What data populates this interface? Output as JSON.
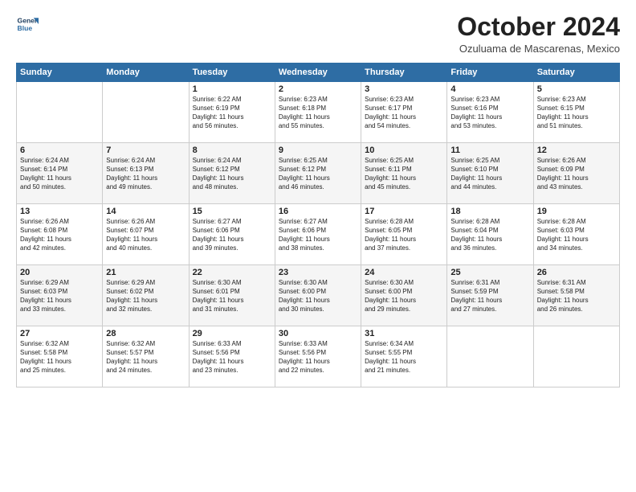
{
  "logo": {
    "line1": "General",
    "line2": "Blue"
  },
  "title": "October 2024",
  "subtitle": "Ozuluama de Mascarenas, Mexico",
  "weekdays": [
    "Sunday",
    "Monday",
    "Tuesday",
    "Wednesday",
    "Thursday",
    "Friday",
    "Saturday"
  ],
  "weeks": [
    [
      {
        "day": "",
        "text": ""
      },
      {
        "day": "",
        "text": ""
      },
      {
        "day": "1",
        "text": "Sunrise: 6:22 AM\nSunset: 6:19 PM\nDaylight: 11 hours\nand 56 minutes."
      },
      {
        "day": "2",
        "text": "Sunrise: 6:23 AM\nSunset: 6:18 PM\nDaylight: 11 hours\nand 55 minutes."
      },
      {
        "day": "3",
        "text": "Sunrise: 6:23 AM\nSunset: 6:17 PM\nDaylight: 11 hours\nand 54 minutes."
      },
      {
        "day": "4",
        "text": "Sunrise: 6:23 AM\nSunset: 6:16 PM\nDaylight: 11 hours\nand 53 minutes."
      },
      {
        "day": "5",
        "text": "Sunrise: 6:23 AM\nSunset: 6:15 PM\nDaylight: 11 hours\nand 51 minutes."
      }
    ],
    [
      {
        "day": "6",
        "text": "Sunrise: 6:24 AM\nSunset: 6:14 PM\nDaylight: 11 hours\nand 50 minutes."
      },
      {
        "day": "7",
        "text": "Sunrise: 6:24 AM\nSunset: 6:13 PM\nDaylight: 11 hours\nand 49 minutes."
      },
      {
        "day": "8",
        "text": "Sunrise: 6:24 AM\nSunset: 6:12 PM\nDaylight: 11 hours\nand 48 minutes."
      },
      {
        "day": "9",
        "text": "Sunrise: 6:25 AM\nSunset: 6:12 PM\nDaylight: 11 hours\nand 46 minutes."
      },
      {
        "day": "10",
        "text": "Sunrise: 6:25 AM\nSunset: 6:11 PM\nDaylight: 11 hours\nand 45 minutes."
      },
      {
        "day": "11",
        "text": "Sunrise: 6:25 AM\nSunset: 6:10 PM\nDaylight: 11 hours\nand 44 minutes."
      },
      {
        "day": "12",
        "text": "Sunrise: 6:26 AM\nSunset: 6:09 PM\nDaylight: 11 hours\nand 43 minutes."
      }
    ],
    [
      {
        "day": "13",
        "text": "Sunrise: 6:26 AM\nSunset: 6:08 PM\nDaylight: 11 hours\nand 42 minutes."
      },
      {
        "day": "14",
        "text": "Sunrise: 6:26 AM\nSunset: 6:07 PM\nDaylight: 11 hours\nand 40 minutes."
      },
      {
        "day": "15",
        "text": "Sunrise: 6:27 AM\nSunset: 6:06 PM\nDaylight: 11 hours\nand 39 minutes."
      },
      {
        "day": "16",
        "text": "Sunrise: 6:27 AM\nSunset: 6:06 PM\nDaylight: 11 hours\nand 38 minutes."
      },
      {
        "day": "17",
        "text": "Sunrise: 6:28 AM\nSunset: 6:05 PM\nDaylight: 11 hours\nand 37 minutes."
      },
      {
        "day": "18",
        "text": "Sunrise: 6:28 AM\nSunset: 6:04 PM\nDaylight: 11 hours\nand 36 minutes."
      },
      {
        "day": "19",
        "text": "Sunrise: 6:28 AM\nSunset: 6:03 PM\nDaylight: 11 hours\nand 34 minutes."
      }
    ],
    [
      {
        "day": "20",
        "text": "Sunrise: 6:29 AM\nSunset: 6:03 PM\nDaylight: 11 hours\nand 33 minutes."
      },
      {
        "day": "21",
        "text": "Sunrise: 6:29 AM\nSunset: 6:02 PM\nDaylight: 11 hours\nand 32 minutes."
      },
      {
        "day": "22",
        "text": "Sunrise: 6:30 AM\nSunset: 6:01 PM\nDaylight: 11 hours\nand 31 minutes."
      },
      {
        "day": "23",
        "text": "Sunrise: 6:30 AM\nSunset: 6:00 PM\nDaylight: 11 hours\nand 30 minutes."
      },
      {
        "day": "24",
        "text": "Sunrise: 6:30 AM\nSunset: 6:00 PM\nDaylight: 11 hours\nand 29 minutes."
      },
      {
        "day": "25",
        "text": "Sunrise: 6:31 AM\nSunset: 5:59 PM\nDaylight: 11 hours\nand 27 minutes."
      },
      {
        "day": "26",
        "text": "Sunrise: 6:31 AM\nSunset: 5:58 PM\nDaylight: 11 hours\nand 26 minutes."
      }
    ],
    [
      {
        "day": "27",
        "text": "Sunrise: 6:32 AM\nSunset: 5:58 PM\nDaylight: 11 hours\nand 25 minutes."
      },
      {
        "day": "28",
        "text": "Sunrise: 6:32 AM\nSunset: 5:57 PM\nDaylight: 11 hours\nand 24 minutes."
      },
      {
        "day": "29",
        "text": "Sunrise: 6:33 AM\nSunset: 5:56 PM\nDaylight: 11 hours\nand 23 minutes."
      },
      {
        "day": "30",
        "text": "Sunrise: 6:33 AM\nSunset: 5:56 PM\nDaylight: 11 hours\nand 22 minutes."
      },
      {
        "day": "31",
        "text": "Sunrise: 6:34 AM\nSunset: 5:55 PM\nDaylight: 11 hours\nand 21 minutes."
      },
      {
        "day": "",
        "text": ""
      },
      {
        "day": "",
        "text": ""
      }
    ]
  ]
}
